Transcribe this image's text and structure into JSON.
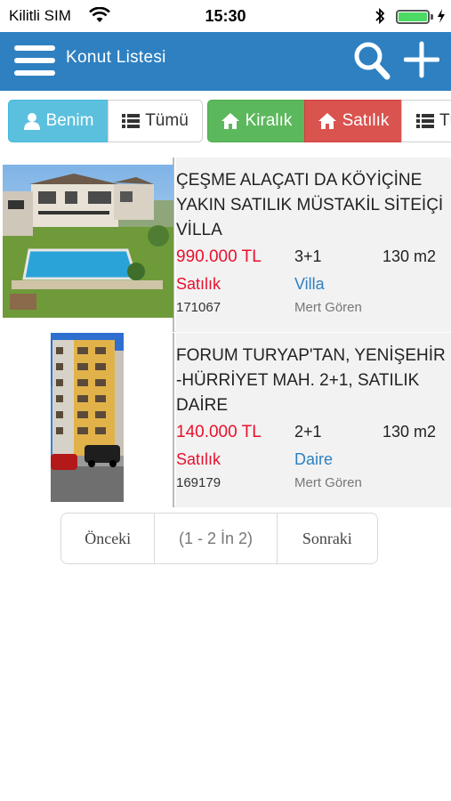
{
  "status_bar": {
    "carrier": "Kilitli SIM",
    "time": "15:30",
    "battery_level": 1.0
  },
  "nav": {
    "title": "Konut Listesi"
  },
  "filters": {
    "owner_group": [
      "Benim",
      "Tümü"
    ],
    "type_group": [
      "Kiralık",
      "Satılık",
      "Tü"
    ]
  },
  "listings": [
    {
      "title": "ÇEŞME ALAÇATI DA KÖYİÇİNE YAKIN SATILIK MÜSTAKİL SİTEİÇİ VİLLA",
      "price": "990.000 TL",
      "rooms": "3+1",
      "area": "130 m2",
      "status": "Satılık",
      "type": "Villa",
      "id": "171067",
      "agent": "Mert Gören"
    },
    {
      "title": "FORUM TURYAP'TAN, YENİŞEHİR -HÜRRİYET MAH. 2+1, SATILIK DAİRE",
      "price": "140.000 TL",
      "rooms": "2+1",
      "area": "130 m2",
      "status": "Satılık",
      "type": "Daire",
      "id": "169179",
      "agent": "Mert Gören"
    }
  ],
  "pager": {
    "prev": "Önceki",
    "info": "(1 - 2 İn 2)",
    "next": "Sonraki"
  },
  "colors": {
    "nav_bg": "#2e80c1",
    "price": "#e8112d",
    "benim": "#5bc0de",
    "kiralik": "#5cb85c",
    "satilik": "#d9534f"
  }
}
